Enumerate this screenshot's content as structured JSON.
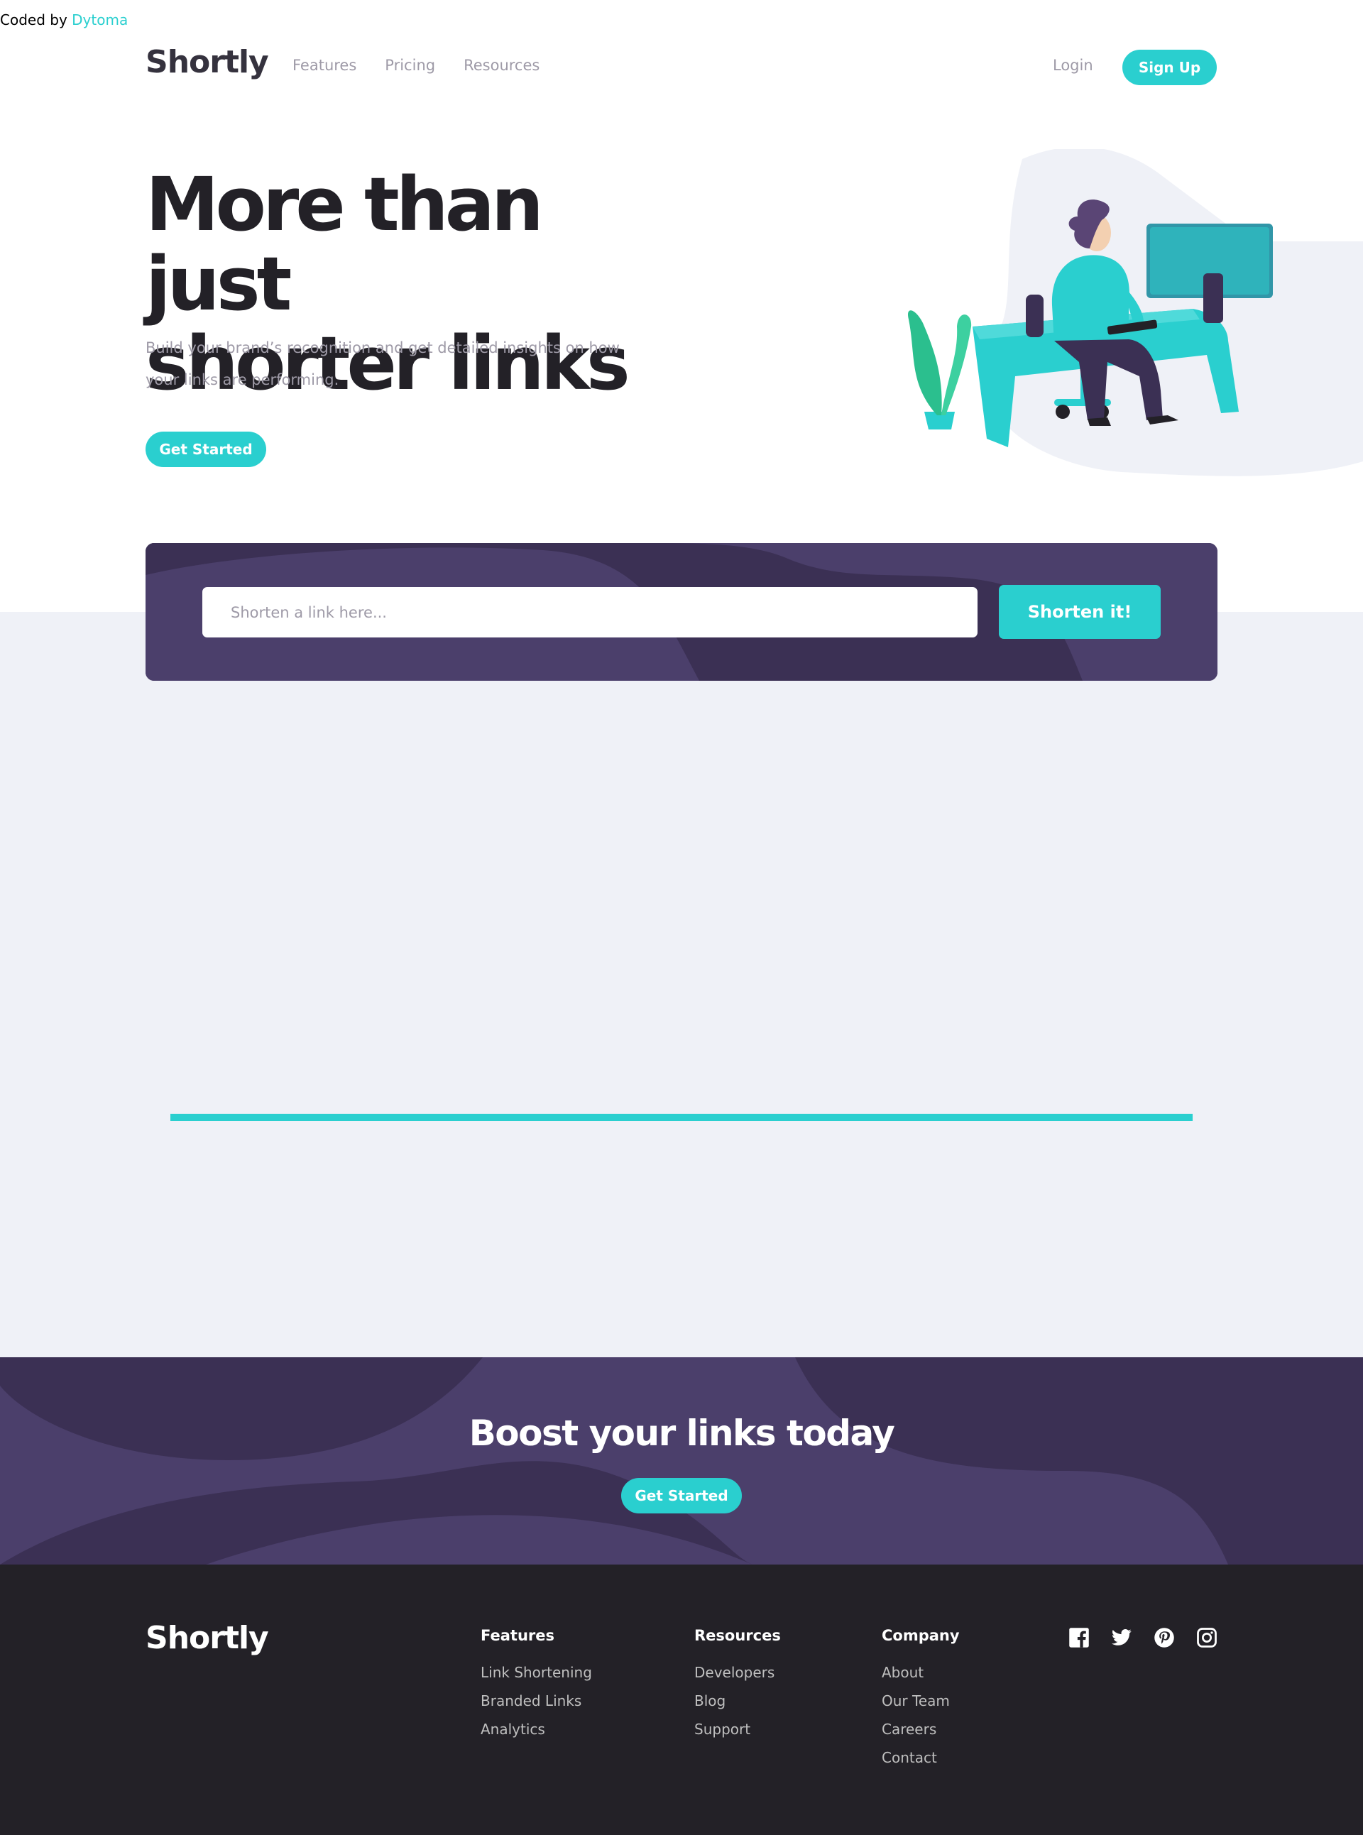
{
  "credit": {
    "prefix": "Coded by ",
    "author": "Dytoma"
  },
  "header": {
    "logo": "Shortly",
    "nav": [
      "Features",
      "Pricing",
      "Resources"
    ],
    "login": "Login",
    "signup": "Sign Up"
  },
  "hero": {
    "title_line1": "More than just",
    "title_line2": "shorter links",
    "subtitle": "Build your brand’s recognition and get detailed insights on how your links are performing.",
    "cta": "Get Started"
  },
  "shorten": {
    "placeholder": "Shorten a link here...",
    "button": "Shorten it!"
  },
  "boost": {
    "title": "Boost your links today",
    "cta": "Get Started"
  },
  "footer": {
    "logo": "Shortly",
    "columns": [
      {
        "title": "Features",
        "links": [
          "Link Shortening",
          "Branded Links",
          "Analytics"
        ]
      },
      {
        "title": "Resources",
        "links": [
          "Developers",
          "Blog",
          "Support"
        ]
      },
      {
        "title": "Company",
        "links": [
          "About",
          "Our Team",
          "Careers",
          "Contact"
        ]
      }
    ],
    "socials": [
      "facebook-icon",
      "twitter-icon",
      "pinterest-icon",
      "instagram-icon"
    ]
  },
  "colors": {
    "primary": "#2acfcf",
    "dark_violet": "#3b3054",
    "grey_bg": "#eff1f7",
    "very_dark": "#232127",
    "grey_text": "#9e9aa7"
  }
}
